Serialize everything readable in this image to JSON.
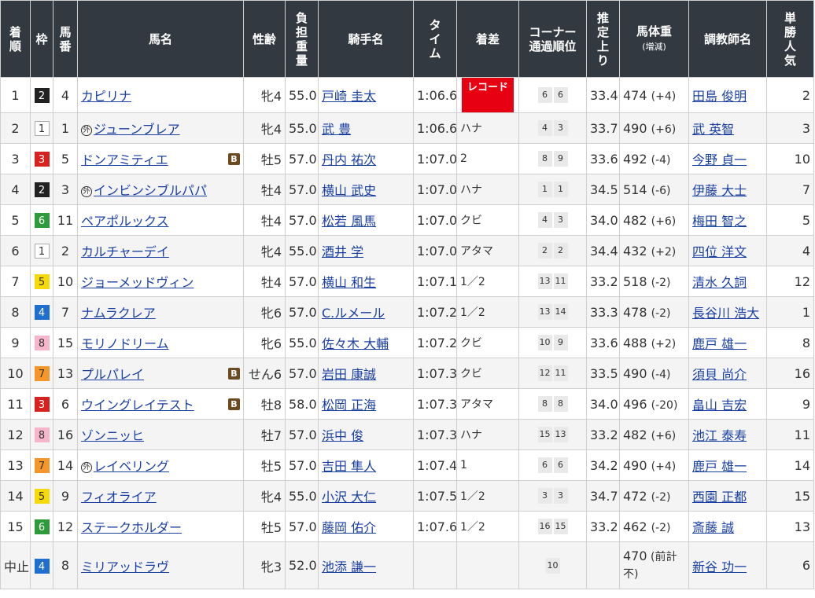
{
  "headers": [
    [
      "着",
      "順"
    ],
    [
      "枠"
    ],
    [
      "馬",
      "番"
    ],
    [
      "馬名"
    ],
    [
      "性齢"
    ],
    [
      "負",
      "担",
      "重",
      "量"
    ],
    [
      "騎手名"
    ],
    [
      "タ",
      "イ",
      "ム"
    ],
    [
      "着差"
    ],
    [
      "コーナー",
      "通過順位"
    ],
    [
      "推",
      "定",
      "上",
      "り"
    ],
    [
      "馬体重",
      "(増減)"
    ],
    [
      "調教師名"
    ],
    [
      "単",
      "勝",
      "人",
      "気"
    ]
  ],
  "frame_colors": {
    "1": {
      "bg": "#ffffff",
      "fg": "#333333"
    },
    "2": {
      "bg": "#222222",
      "fg": "#ffffff"
    },
    "3": {
      "bg": "#d9221f",
      "fg": "#ffffff"
    },
    "4": {
      "bg": "#1e6fd0",
      "fg": "#ffffff"
    },
    "5": {
      "bg": "#f5d90a",
      "fg": "#333333"
    },
    "6": {
      "bg": "#2e9b3a",
      "fg": "#ffffff"
    },
    "7": {
      "bg": "#f4962a",
      "fg": "#333333"
    },
    "8": {
      "bg": "#f7b5cc",
      "fg": "#333333"
    }
  },
  "badges": {
    "foreign": "外",
    "blinker": "B"
  },
  "rows": [
    {
      "rank": "1",
      "waku": "2",
      "umaban": "4",
      "horse": "カピリナ",
      "foreign": false,
      "blinker": false,
      "sex_age": "牝4",
      "weight": "55.0",
      "jockey": "戸崎 圭太",
      "time": "1:06.6",
      "margin": "",
      "record": "レコード",
      "corner": [
        "6",
        "6"
      ],
      "last3f": "33.4",
      "body": "474",
      "diff": "(+4)",
      "trainer": "田島 俊明",
      "pop": "2"
    },
    {
      "rank": "2",
      "waku": "1",
      "umaban": "1",
      "horse": "ジューンブレア",
      "foreign": true,
      "blinker": false,
      "sex_age": "牝4",
      "weight": "55.0",
      "jockey": "武 豊",
      "time": "1:06.6",
      "margin": "ハナ",
      "record": "",
      "corner": [
        "4",
        "3"
      ],
      "last3f": "33.7",
      "body": "490",
      "diff": "(+6)",
      "trainer": "武 英智",
      "pop": "3"
    },
    {
      "rank": "3",
      "waku": "3",
      "umaban": "5",
      "horse": "ドンアミティエ",
      "foreign": false,
      "blinker": true,
      "sex_age": "牡5",
      "weight": "57.0",
      "jockey": "丹内 祐次",
      "time": "1:07.0",
      "margin": "2",
      "record": "",
      "corner": [
        "8",
        "9"
      ],
      "last3f": "33.6",
      "body": "492",
      "diff": "(-4)",
      "trainer": "今野 貞一",
      "pop": "10"
    },
    {
      "rank": "4",
      "waku": "2",
      "umaban": "3",
      "horse": "インビンシブルパパ",
      "foreign": true,
      "blinker": false,
      "sex_age": "牡4",
      "weight": "57.0",
      "jockey": "横山 武史",
      "time": "1:07.0",
      "margin": "ハナ",
      "record": "",
      "corner": [
        "1",
        "1"
      ],
      "last3f": "34.5",
      "body": "514",
      "diff": "(-6)",
      "trainer": "伊藤 大士",
      "pop": "7"
    },
    {
      "rank": "5",
      "waku": "6",
      "umaban": "11",
      "horse": "ペアポルックス",
      "foreign": false,
      "blinker": false,
      "sex_age": "牡4",
      "weight": "57.0",
      "jockey": "松若 風馬",
      "time": "1:07.0",
      "margin": "クビ",
      "record": "",
      "corner": [
        "4",
        "3"
      ],
      "last3f": "34.0",
      "body": "482",
      "diff": "(+6)",
      "trainer": "梅田 智之",
      "pop": "5"
    },
    {
      "rank": "6",
      "waku": "1",
      "umaban": "2",
      "horse": "カルチャーデイ",
      "foreign": false,
      "blinker": false,
      "sex_age": "牝4",
      "weight": "55.0",
      "jockey": "酒井 学",
      "time": "1:07.0",
      "margin": "アタマ",
      "record": "",
      "corner": [
        "2",
        "2"
      ],
      "last3f": "34.4",
      "body": "432",
      "diff": "(+2)",
      "trainer": "四位 洋文",
      "pop": "4"
    },
    {
      "rank": "7",
      "waku": "5",
      "umaban": "10",
      "horse": "ジョーメッドヴィン",
      "foreign": false,
      "blinker": false,
      "sex_age": "牡4",
      "weight": "57.0",
      "jockey": "横山 和生",
      "time": "1:07.1",
      "margin": "1／2",
      "record": "",
      "corner": [
        "13",
        "11"
      ],
      "last3f": "33.2",
      "body": "518",
      "diff": "(-2)",
      "trainer": "清水 久詞",
      "pop": "12"
    },
    {
      "rank": "8",
      "waku": "4",
      "umaban": "7",
      "horse": "ナムラクレア",
      "foreign": false,
      "blinker": false,
      "sex_age": "牝6",
      "weight": "57.0",
      "jockey": "C.ルメール",
      "time": "1:07.2",
      "margin": "1／2",
      "record": "",
      "corner": [
        "13",
        "14"
      ],
      "last3f": "33.3",
      "body": "478",
      "diff": "(-2)",
      "trainer": "長谷川 浩大",
      "pop": "1"
    },
    {
      "rank": "9",
      "waku": "8",
      "umaban": "15",
      "horse": "モリノドリーム",
      "foreign": false,
      "blinker": false,
      "sex_age": "牝6",
      "weight": "55.0",
      "jockey": "佐々木 大輔",
      "time": "1:07.2",
      "margin": "クビ",
      "record": "",
      "corner": [
        "10",
        "9"
      ],
      "last3f": "33.6",
      "body": "488",
      "diff": "(+2)",
      "trainer": "鹿戸 雄一",
      "pop": "8"
    },
    {
      "rank": "10",
      "waku": "7",
      "umaban": "13",
      "horse": "プルパレイ",
      "foreign": false,
      "blinker": true,
      "sex_age": "せん6",
      "weight": "57.0",
      "jockey": "岩田 康誠",
      "time": "1:07.3",
      "margin": "クビ",
      "record": "",
      "corner": [
        "12",
        "11"
      ],
      "last3f": "33.5",
      "body": "490",
      "diff": "(-4)",
      "trainer": "須貝 尚介",
      "pop": "16"
    },
    {
      "rank": "11",
      "waku": "3",
      "umaban": "6",
      "horse": "ウイングレイテスト",
      "foreign": false,
      "blinker": true,
      "sex_age": "牡8",
      "weight": "58.0",
      "jockey": "松岡 正海",
      "time": "1:07.3",
      "margin": "アタマ",
      "record": "",
      "corner": [
        "8",
        "8"
      ],
      "last3f": "34.0",
      "body": "496",
      "diff": "(-20)",
      "trainer": "畠山 吉宏",
      "pop": "9"
    },
    {
      "rank": "12",
      "waku": "8",
      "umaban": "16",
      "horse": "ゾンニッヒ",
      "foreign": false,
      "blinker": false,
      "sex_age": "牡7",
      "weight": "57.0",
      "jockey": "浜中 俊",
      "time": "1:07.3",
      "margin": "ハナ",
      "record": "",
      "corner": [
        "15",
        "13"
      ],
      "last3f": "33.2",
      "body": "482",
      "diff": "(+6)",
      "trainer": "池江 泰寿",
      "pop": "11"
    },
    {
      "rank": "13",
      "waku": "7",
      "umaban": "14",
      "horse": "レイベリング",
      "foreign": true,
      "blinker": false,
      "sex_age": "牡5",
      "weight": "57.0",
      "jockey": "吉田 隼人",
      "time": "1:07.4",
      "margin": "1",
      "record": "",
      "corner": [
        "6",
        "6"
      ],
      "last3f": "34.2",
      "body": "490",
      "diff": "(+4)",
      "trainer": "鹿戸 雄一",
      "pop": "14"
    },
    {
      "rank": "14",
      "waku": "5",
      "umaban": "9",
      "horse": "フィオライア",
      "foreign": false,
      "blinker": false,
      "sex_age": "牝4",
      "weight": "55.0",
      "jockey": "小沢 大仁",
      "time": "1:07.5",
      "margin": "1／2",
      "record": "",
      "corner": [
        "3",
        "3"
      ],
      "last3f": "34.7",
      "body": "472",
      "diff": "(-2)",
      "trainer": "西園 正都",
      "pop": "15"
    },
    {
      "rank": "15",
      "waku": "6",
      "umaban": "12",
      "horse": "ステークホルダー",
      "foreign": false,
      "blinker": false,
      "sex_age": "牡5",
      "weight": "57.0",
      "jockey": "藤岡 佑介",
      "time": "1:07.6",
      "margin": "1／2",
      "record": "",
      "corner": [
        "16",
        "15"
      ],
      "last3f": "33.2",
      "body": "462",
      "diff": "(-2)",
      "trainer": "斎藤 誠",
      "pop": "13"
    },
    {
      "rank": "中止",
      "waku": "4",
      "umaban": "8",
      "horse": "ミリアッドラヴ",
      "foreign": false,
      "blinker": false,
      "sex_age": "牝3",
      "weight": "52.0",
      "jockey": "池添 謙一",
      "time": "",
      "margin": "",
      "record": "",
      "corner": [
        "10"
      ],
      "last3f": "",
      "body": "470",
      "diff": "(前計不)",
      "trainer": "新谷 功一",
      "pop": "6"
    }
  ]
}
